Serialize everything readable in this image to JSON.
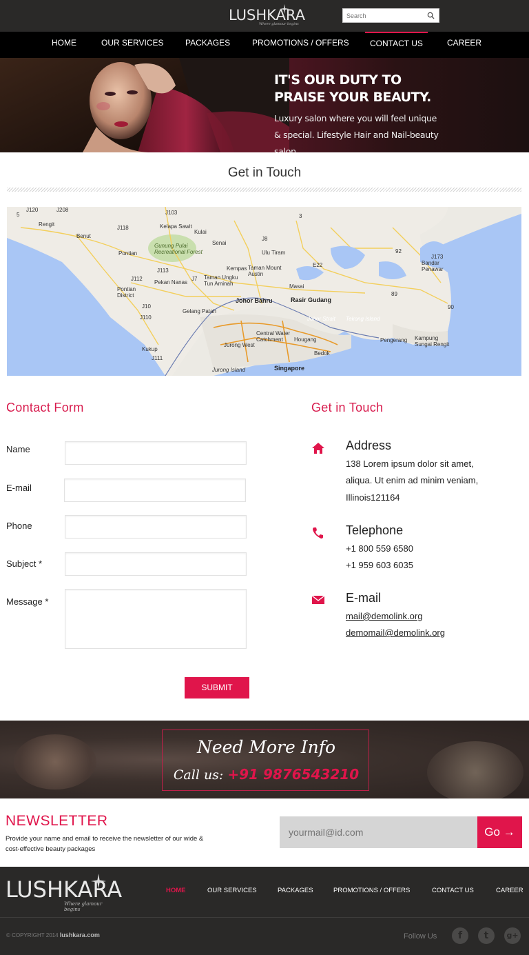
{
  "brand": {
    "name": "LUSHKARA",
    "tagline": "Where glamour begins",
    "accent": "#e0154b"
  },
  "search": {
    "placeholder": "Search",
    "icon": "search-icon"
  },
  "nav": {
    "items": [
      {
        "label": "HOME"
      },
      {
        "label": "OUR SERVICES"
      },
      {
        "label": "PACKAGES"
      },
      {
        "label": "PROMOTIONS / OFFERS"
      },
      {
        "label": "CONTACT US",
        "active": true
      },
      {
        "label": "CAREER"
      }
    ]
  },
  "banner": {
    "headline": "IT'S OUR DUTY TO PRAISE YOUR BEAUTY.",
    "text": "Luxury salon where you will feel unique & special. Lifestyle Hair and Nail-beauty salon ."
  },
  "page_title": "Get in Touch",
  "map": {
    "places": [
      "Johor Bahru",
      "Senai",
      "Kulai",
      "Ulu Tiram",
      "Kempas",
      "Taman Mount Austin",
      "Taman Ungku Tun Aminah",
      "Pontian",
      "Pontian District",
      "Benut",
      "Rengit",
      "Kelapa Sawit",
      "Gunung Pulai Recreational Forest",
      "Pekan Nanas",
      "Gelang Patah",
      "Masai",
      "Rasir Gudang",
      "Johor Strait",
      "Tekong Island",
      "Pengerang",
      "Kampung Sungai Rengit",
      "Bandar Penawar",
      "Central Water Catchment",
      "Hougang",
      "Bedok",
      "Jurong West",
      "Jurong Island",
      "Singapore",
      "Kukup"
    ],
    "roads": [
      "J120",
      "J208",
      "J103",
      "J118",
      "J8",
      "J112",
      "J113",
      "J7",
      "J10",
      "J110",
      "J111",
      "J173",
      "5",
      "3",
      "92",
      "89",
      "90",
      "E22"
    ]
  },
  "contact_form": {
    "title": "Contact Form",
    "fields": [
      {
        "label": "Name",
        "value": ""
      },
      {
        "label": "E-mail",
        "value": ""
      },
      {
        "label": "Phone",
        "value": ""
      },
      {
        "label": "Subject *",
        "value": ""
      },
      {
        "label": "Message *",
        "value": ""
      }
    ],
    "submit": "SUBMIT"
  },
  "contact_info": {
    "title": "Get in Touch",
    "address": {
      "title": "Address",
      "lines": [
        "138 Lorem ipsum dolor sit amet,",
        "aliqua. Ut enim ad minim veniam,",
        "Illinois121164"
      ],
      "icon": "home-icon"
    },
    "telephone": {
      "title": "Telephone",
      "lines": [
        "+1 800 559 6580",
        "+1 959 603 6035"
      ],
      "icon": "phone-icon"
    },
    "email": {
      "title": "E-mail",
      "lines": [
        "mail@demolink.org",
        "demomail@demolink.org"
      ],
      "icon": "envelope-icon"
    }
  },
  "more_info": {
    "heading": "Need More Info",
    "call_label": "Call us:",
    "phone": "+91 9876543210"
  },
  "newsletter": {
    "title": "NEWSLETTER",
    "text": "Provide your name and email to receive the newsletter of our wide & cost-effective beauty packages",
    "placeholder": "yourmail@id.com",
    "button": "Go →"
  },
  "footer": {
    "nav": [
      "HOME",
      "OUR SERVICES",
      "PACKAGES",
      "PROMOTIONS / OFFERS",
      "CONTACT US",
      "CAREER"
    ],
    "copyright": "© COPYRIGHT 2014",
    "site": "lushkara.com",
    "follow": "Follow Us",
    "social": [
      "facebook-icon",
      "twitter-icon",
      "google-plus-icon"
    ]
  }
}
